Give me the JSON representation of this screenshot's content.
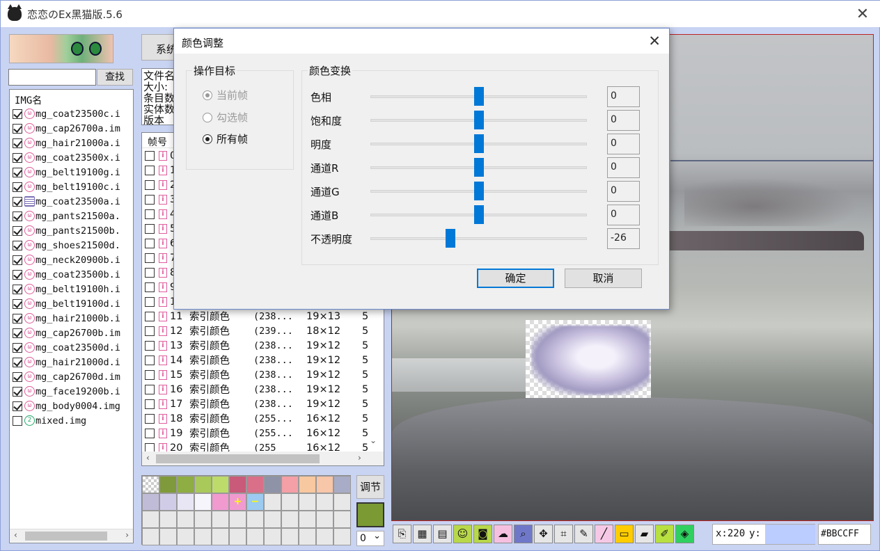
{
  "app": {
    "title": "恋恋のEx黑猫版.5.6"
  },
  "search": {
    "placeholder": "",
    "button": "查找"
  },
  "img_list": {
    "header": "IMG名",
    "items": [
      {
        "name": "mg_coat23500c.i",
        "checked": true,
        "icon": "pink-cat-icon"
      },
      {
        "name": "mg_cap26700a.im",
        "checked": true,
        "icon": "pink-cat-icon"
      },
      {
        "name": "mg_hair21000a.i",
        "checked": true,
        "icon": "pink-cat-icon"
      },
      {
        "name": "mg_coat23500x.i",
        "checked": true,
        "icon": "pink-cat-icon"
      },
      {
        "name": "mg_belt19100g.i",
        "checked": true,
        "icon": "pink-cat-icon"
      },
      {
        "name": "mg_belt19100c.i",
        "checked": true,
        "icon": "pink-cat-icon"
      },
      {
        "name": "mg_coat23500a.i",
        "checked": true,
        "icon": "grid-icon"
      },
      {
        "name": "mg_pants21500a.",
        "checked": true,
        "icon": "pink-cat-icon"
      },
      {
        "name": "mg_pants21500b.",
        "checked": true,
        "icon": "pink-cat-icon"
      },
      {
        "name": "mg_shoes21500d.",
        "checked": true,
        "icon": "pink-cat-icon"
      },
      {
        "name": "mg_neck20900b.i",
        "checked": true,
        "icon": "pink-cat-icon"
      },
      {
        "name": "mg_coat23500b.i",
        "checked": true,
        "icon": "pink-cat-icon"
      },
      {
        "name": "mg_belt19100h.i",
        "checked": true,
        "icon": "pink-cat-icon"
      },
      {
        "name": "mg_belt19100d.i",
        "checked": true,
        "icon": "pink-cat-icon"
      },
      {
        "name": "mg_hair21000b.i",
        "checked": true,
        "icon": "pink-cat-icon"
      },
      {
        "name": "mg_cap26700b.im",
        "checked": true,
        "icon": "pink-cat-icon"
      },
      {
        "name": "mg_coat23500d.i",
        "checked": true,
        "icon": "pink-cat-icon"
      },
      {
        "name": "mg_hair21000d.i",
        "checked": true,
        "icon": "pink-cat-icon"
      },
      {
        "name": "mg_cap26700d.im",
        "checked": true,
        "icon": "pink-cat-icon"
      },
      {
        "name": "mg_face19200b.i",
        "checked": true,
        "icon": "pink-cat-icon"
      },
      {
        "name": "mg_body0004.img",
        "checked": true,
        "icon": "pink-cat-icon"
      },
      {
        "name": "mixed.img",
        "checked": false,
        "icon": "green-2-icon"
      }
    ]
  },
  "sys_button": "系统",
  "info_lines": [
    "文件名",
    "大小:",
    "条目数",
    "实体数",
    "版本"
  ],
  "frames": {
    "header": "帧号",
    "rows": [
      {
        "no": "0",
        "type": "",
        "color": "",
        "size": "",
        "x": ""
      },
      {
        "no": "1",
        "type": "",
        "color": "",
        "size": "",
        "x": ""
      },
      {
        "no": "2",
        "type": "",
        "color": "",
        "size": "",
        "x": ""
      },
      {
        "no": "3",
        "type": "",
        "color": "",
        "size": "",
        "x": ""
      },
      {
        "no": "4",
        "type": "",
        "color": "",
        "size": "",
        "x": ""
      },
      {
        "no": "5",
        "type": "",
        "color": "",
        "size": "",
        "x": ""
      },
      {
        "no": "6",
        "type": "",
        "color": "",
        "size": "",
        "x": ""
      },
      {
        "no": "7",
        "type": "",
        "color": "",
        "size": "",
        "x": ""
      },
      {
        "no": "8",
        "type": "",
        "color": "",
        "size": "",
        "x": ""
      },
      {
        "no": "9",
        "type": "",
        "color": "",
        "size": "",
        "x": ""
      },
      {
        "no": "1",
        "type": "",
        "color": "",
        "size": "",
        "x": ""
      },
      {
        "no": "11",
        "type": "索引颜色",
        "color": "(238...",
        "size": "19×13",
        "x": "5"
      },
      {
        "no": "12",
        "type": "索引颜色",
        "color": "(239...",
        "size": "18×12",
        "x": "5"
      },
      {
        "no": "13",
        "type": "索引颜色",
        "color": "(238...",
        "size": "19×12",
        "x": "5"
      },
      {
        "no": "14",
        "type": "索引颜色",
        "color": "(238...",
        "size": "19×12",
        "x": "5"
      },
      {
        "no": "15",
        "type": "索引颜色",
        "color": "(238...",
        "size": "19×12",
        "x": "5"
      },
      {
        "no": "16",
        "type": "索引颜色",
        "color": "(238...",
        "size": "19×12",
        "x": "5"
      },
      {
        "no": "17",
        "type": "索引颜色",
        "color": "(238...",
        "size": "19×12",
        "x": "5"
      },
      {
        "no": "18",
        "type": "索引颜色",
        "color": "(255...",
        "size": "16×12",
        "x": "5"
      },
      {
        "no": "19",
        "type": "索引颜色",
        "color": "(255...",
        "size": "16×12",
        "x": "5"
      },
      {
        "no": "20",
        "type": "索引颜色",
        "color": "(255",
        "size": "16×12",
        "x": "5"
      }
    ]
  },
  "palette": {
    "colors": [
      "#7f9a3a",
      "#8ead42",
      "#a9c95a",
      "#bcdb6a",
      "#c95a7a",
      "#d96f88",
      "#8f93a8",
      "#f4a0a6",
      "#f8c8a0",
      "#f8c6a8",
      "#a8acc6",
      "#c0bcd8",
      "#d0cce8",
      "#e8e6f4",
      "#f6f5fb",
      "#f09ad0",
      "#9ccaf0"
    ],
    "adjust_button": "调节",
    "current_color": "#7b9a34",
    "frame_index": "0"
  },
  "coords": {
    "x_label": "x:220",
    "y_label": "y:",
    "hex": "#BBCCFF"
  },
  "dialog": {
    "title": "颜色调整",
    "target_group": "操作目标",
    "targets": [
      {
        "label": "当前帧",
        "state": "disabled-selected"
      },
      {
        "label": "勾选帧",
        "state": "disabled"
      },
      {
        "label": "所有帧",
        "state": "selected"
      }
    ],
    "transform_group": "颜色变换",
    "sliders": [
      {
        "label": "色相",
        "value": "0",
        "level": 0.5
      },
      {
        "label": "饱和度",
        "value": "0",
        "level": 0.5
      },
      {
        "label": "明度",
        "value": "0",
        "level": 0.5
      },
      {
        "label": "通道R",
        "value": "0",
        "level": 0.5
      },
      {
        "label": "通道G",
        "value": "0",
        "level": 0.5
      },
      {
        "label": "通道B",
        "value": "0",
        "level": 0.5
      },
      {
        "label": "不透明度",
        "value": "-26",
        "level": 0.37
      }
    ],
    "ok": "确定",
    "cancel": "取消"
  },
  "colors": {
    "accent": "#0078d7",
    "window_bg": "#c9d3f2",
    "highlight": "#bbccff"
  }
}
